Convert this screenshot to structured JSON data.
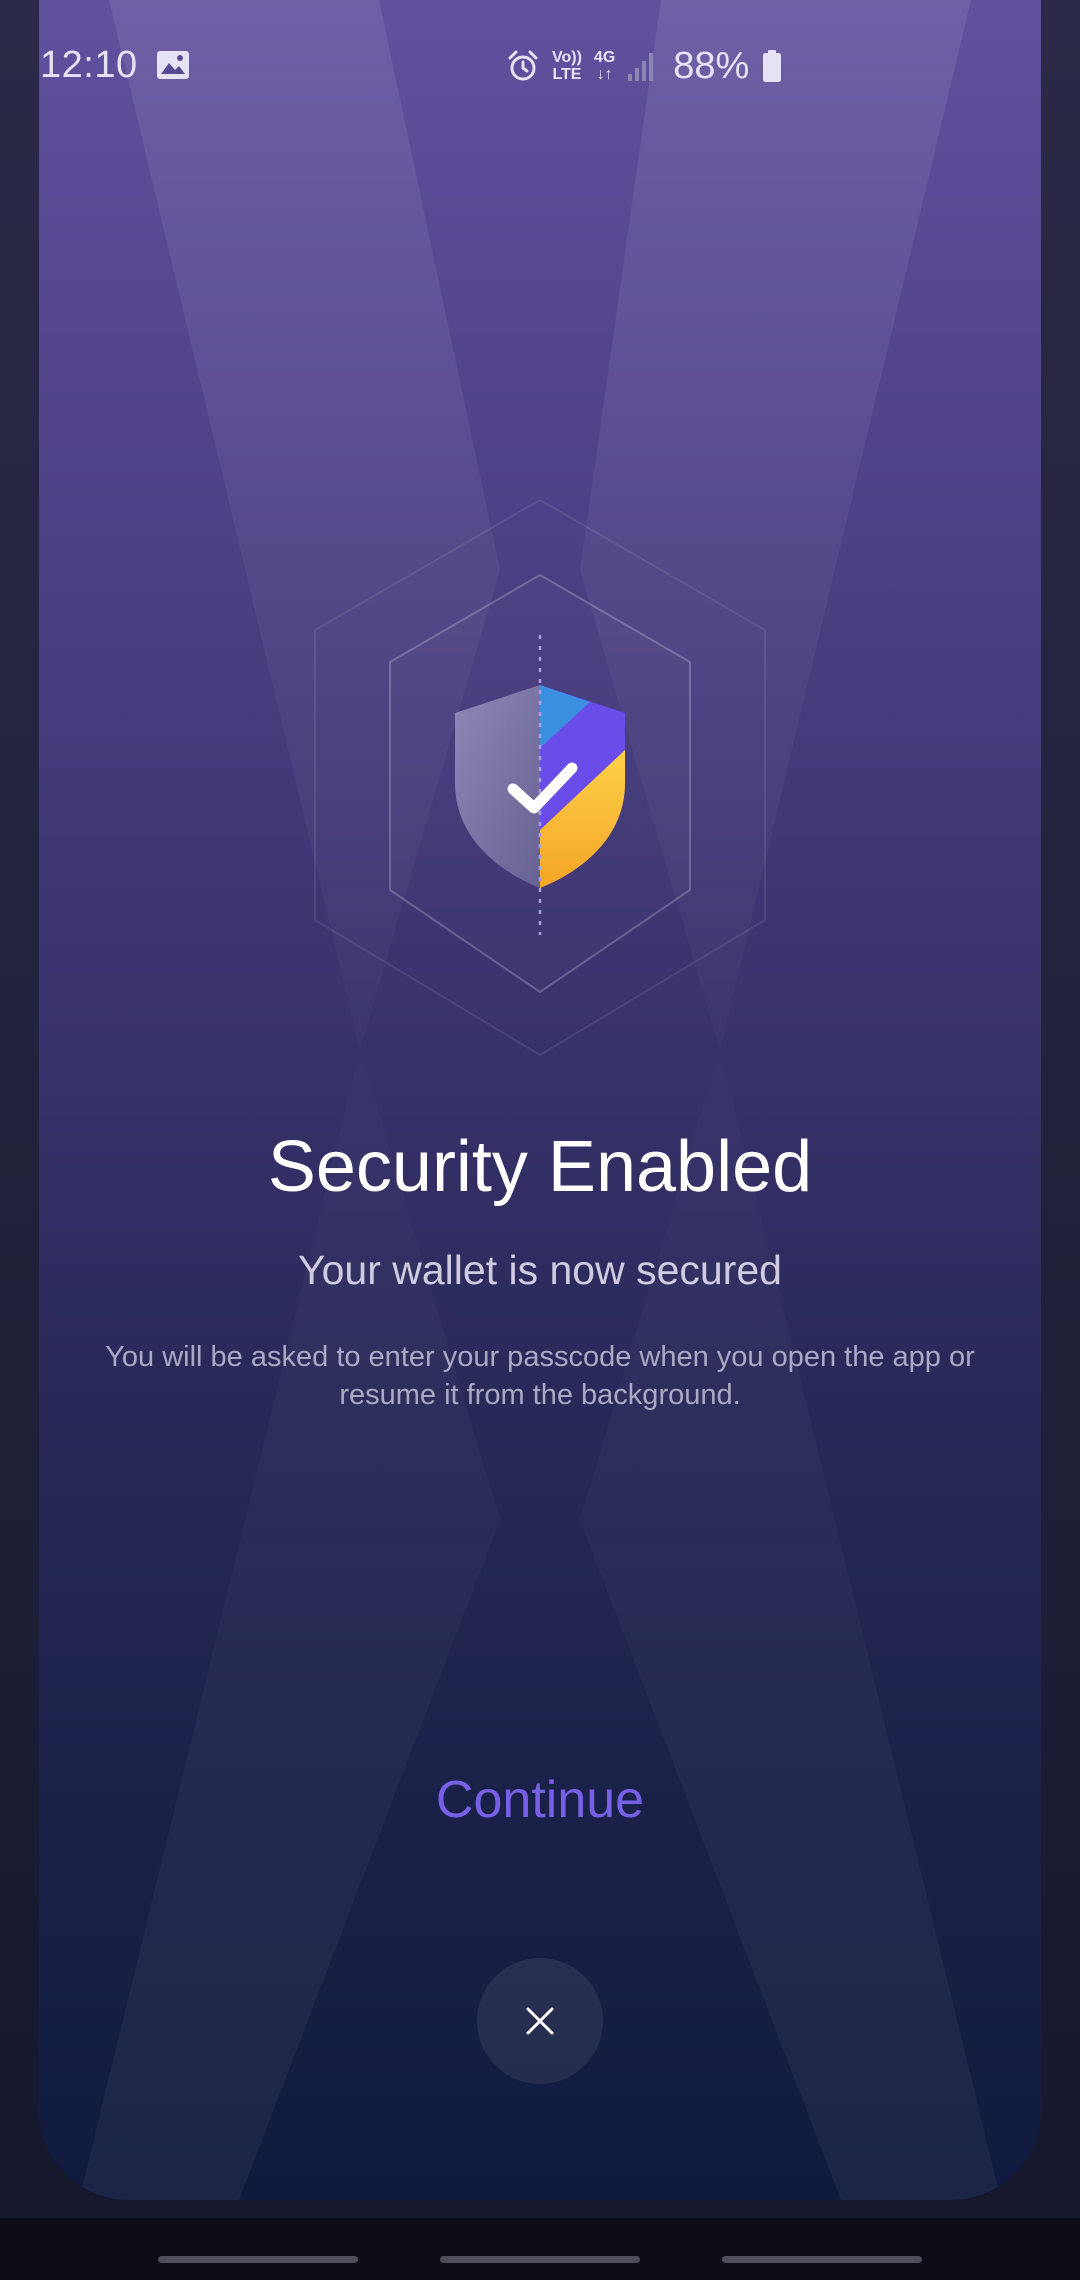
{
  "status_bar": {
    "time": "12:10",
    "gallery_icon": "image-icon",
    "alarm_icon": "alarm-icon",
    "volte_top": "Vo))",
    "volte_bottom": "LTE",
    "network_top": "4G",
    "network_bottom": "↓↑",
    "signal_icon": "signal-icon",
    "battery_text": "88%",
    "battery_icon": "battery-icon",
    "battery_level": 0.88
  },
  "main": {
    "emblem_icon": "shield-check-icon",
    "title": "Security Enabled",
    "subtitle": "Your wallet is now secured",
    "description": "You will be asked to enter your passcode when you open the app or resume it from the background.",
    "continue_label": "Continue",
    "close_icon": "close-icon"
  },
  "colors": {
    "accent": "#7860e6",
    "shield_gray": "#8a84b0",
    "shield_purple": "#6a4de8",
    "shield_blue": "#3a8fe0",
    "shield_yellow": "#f7b52c"
  }
}
